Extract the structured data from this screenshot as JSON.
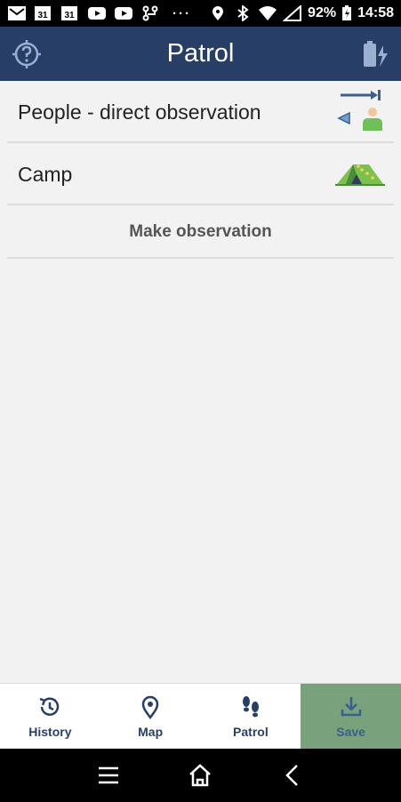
{
  "status_bar": {
    "battery": "92%",
    "time": "14:58",
    "overflow": "···",
    "calendar_day": "31"
  },
  "app_bar": {
    "title": "Patrol",
    "left_icon": "location-help-icon",
    "right_icon": "battery-charging-icon"
  },
  "list": {
    "items": [
      {
        "label": "People - direct observation",
        "icon": "people-observation-icon"
      },
      {
        "label": "Camp",
        "icon": "tent-icon"
      }
    ],
    "action_label": "Make observation"
  },
  "bottom_nav": {
    "items": [
      {
        "label": "History",
        "icon": "history-icon"
      },
      {
        "label": "Map",
        "icon": "map-pin-icon"
      },
      {
        "label": "Patrol",
        "icon": "footprints-icon"
      },
      {
        "label": "Save",
        "icon": "download-icon"
      }
    ]
  },
  "colors": {
    "primary": "#273f66",
    "save_bg": "#79a27c",
    "background": "#f2f2f2"
  }
}
